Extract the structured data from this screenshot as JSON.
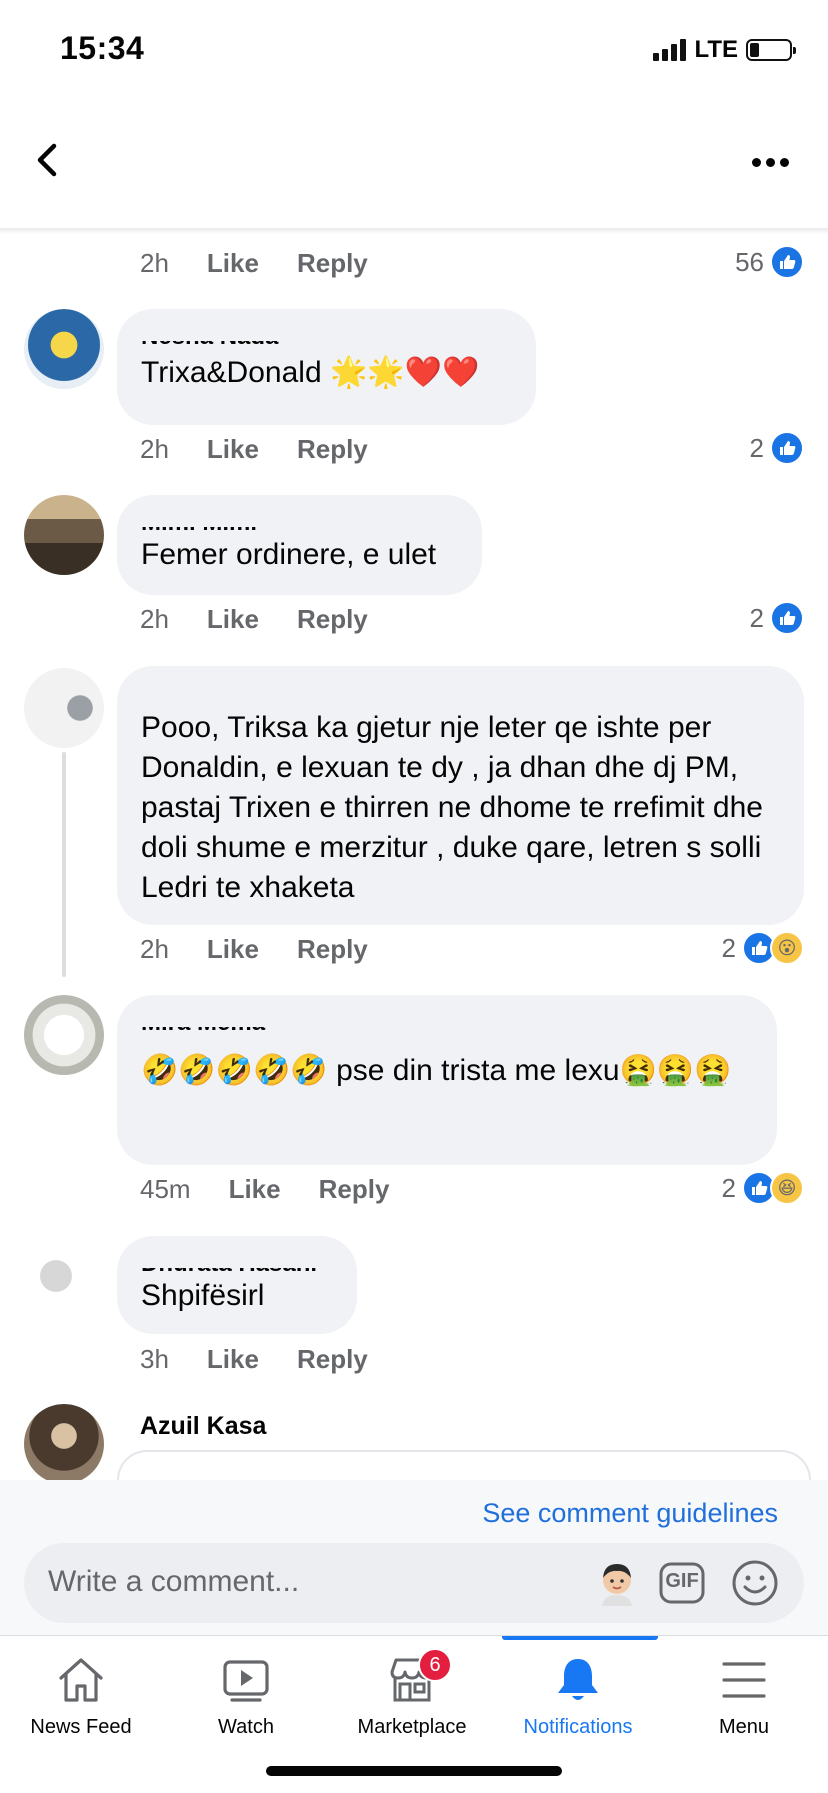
{
  "status": {
    "time": "15:34",
    "network": "LTE"
  },
  "colors": {
    "accent": "#1877f2",
    "like": "#1b74e4",
    "bubble": "#f0f2f5",
    "badge": "#e41e3f"
  },
  "top_meta": {
    "time": "2h",
    "like": "Like",
    "reply": "Reply",
    "reactions": "56"
  },
  "comments": [
    {
      "author": "Nesha Nada",
      "text": "Trixa&Donald 🌟🌟❤️❤️",
      "time": "2h",
      "like": "Like",
      "reply": "Reply",
      "reactions": "2"
    },
    {
      "author": "Mimi Mimi",
      "text": "Femer ordinere, e ulet",
      "time": "2h",
      "like": "Like",
      "reply": "Reply",
      "reactions": "2"
    },
    {
      "author": "",
      "text": "Pooo, Triksa ka gjetur nje leter qe ishte per Donaldin, e lexuan te dy , ja dhan dhe dj PM, pastaj Trixen e thirren ne dhome te rrefimit dhe doli shume e merzitur , duke qare, letren s solli Ledri te xhaketa",
      "time": "2h",
      "like": "Like",
      "reply": "Reply",
      "reactions": "2"
    },
    {
      "author": "Mira Mema",
      "text": "🤣🤣🤣🤣🤣 pse din trista me lexu🤮🤮🤮",
      "time": "45m",
      "like": "Like",
      "reply": "Reply",
      "reactions": "2"
    },
    {
      "author": "Dhurata Hasani",
      "text": "Shpifësirl",
      "time": "3h",
      "like": "Like",
      "reply": "Reply",
      "reactions": ""
    },
    {
      "author": "Azuil Kasa"
    }
  ],
  "composer": {
    "guidelines": "See comment guidelines",
    "placeholder": "Write a comment...",
    "gif": "GIF"
  },
  "tabs": [
    {
      "label": "News Feed",
      "icon": "home-icon"
    },
    {
      "label": "Watch",
      "icon": "watch-icon"
    },
    {
      "label": "Marketplace",
      "icon": "marketplace-icon",
      "badge": "6"
    },
    {
      "label": "Notifications",
      "icon": "bell-icon",
      "active": true
    },
    {
      "label": "Menu",
      "icon": "menu-icon"
    }
  ]
}
